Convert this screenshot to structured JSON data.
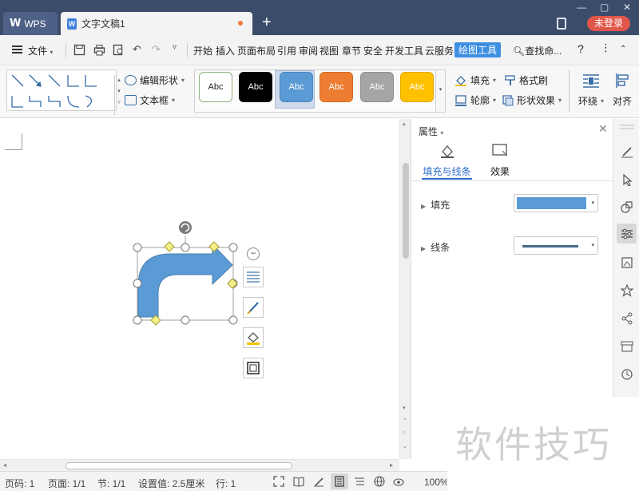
{
  "titlebar": {
    "app_tab": "WPS",
    "doc_tab": "文字文稿1",
    "new_tab": "+",
    "login": "未登录"
  },
  "menu": {
    "file": "文件",
    "items": [
      "开始",
      "插入",
      "页面布局",
      "引用",
      "审阅",
      "视图",
      "章节",
      "安全",
      "开发工具",
      "云服务",
      "绘图工具"
    ],
    "active": "绘图工具",
    "search": "查找命...",
    "help": "?"
  },
  "ribbon": {
    "edit_shape": "编辑形状",
    "text_box": "文本框",
    "styles": [
      {
        "label": "Abc",
        "bg": "#ffffff",
        "fg": "#222222",
        "border": "#8fb07a"
      },
      {
        "label": "Abc",
        "bg": "#000000",
        "fg": "#ffffff",
        "border": "#000000"
      },
      {
        "label": "Abc",
        "bg": "#5b9bd5",
        "fg": "#ffffff",
        "border": "#4a86bf"
      },
      {
        "label": "Abc",
        "bg": "#ed7d31",
        "fg": "#ffffff",
        "border": "#d46a22"
      },
      {
        "label": "Abc",
        "bg": "#a5a5a5",
        "fg": "#ffffff",
        "border": "#8e8e8e"
      },
      {
        "label": "Abc",
        "bg": "#ffc000",
        "fg": "#ffffff",
        "border": "#e1a800"
      }
    ],
    "fill": "填充",
    "format_painter": "格式刷",
    "outline": "轮廓",
    "shape_effects": "形状效果",
    "wrap": "环绕",
    "align": "对齐"
  },
  "panel": {
    "title": "属性",
    "tab_fill_line": "填充与线条",
    "tab_effects": "效果",
    "fill_label": "填充",
    "line_label": "线条",
    "fill_color": "#5b9bd5"
  },
  "status": {
    "page_num": "页码: 1",
    "pages": "页面: 1/1",
    "section": "节: 1/1",
    "setting": "设置值: 2.5厘米",
    "line": "行: 1",
    "zoom": "100%"
  },
  "watermark": "软件技巧"
}
